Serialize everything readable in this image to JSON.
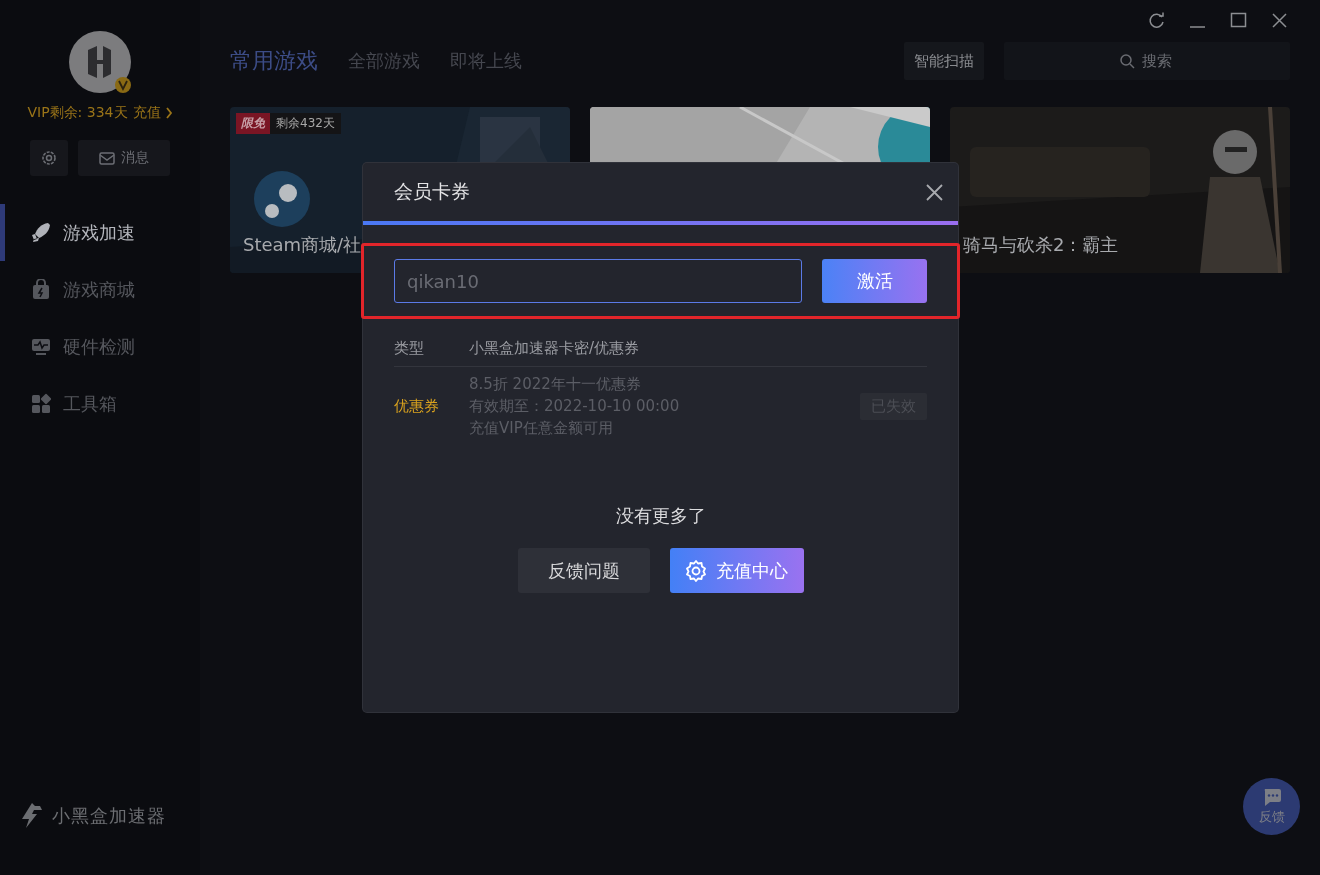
{
  "sidebar": {
    "vip_text": "VIP剩余: 334天",
    "recharge_link": "充值",
    "message_button": "消息",
    "nav": [
      {
        "label": "游戏加速",
        "selected": true
      },
      {
        "label": "游戏商城",
        "selected": false
      },
      {
        "label": "硬件检测",
        "selected": false
      },
      {
        "label": "工具箱",
        "selected": false
      }
    ],
    "brand": "小黑盒加速器"
  },
  "tabs": [
    {
      "label": "常用游戏",
      "selected": true
    },
    {
      "label": "全部游戏",
      "selected": false
    },
    {
      "label": "即将上线",
      "selected": false
    }
  ],
  "scan_button": "智能扫描",
  "search": {
    "placeholder": "搜索"
  },
  "games": [
    {
      "badge": "限免",
      "remaining": "剩余432天",
      "title": "Steam商城/社"
    },
    {
      "kind": "picture"
    },
    {
      "title": "骑马与砍杀2：霸主"
    }
  ],
  "modal": {
    "title": "会员卡券",
    "code": "qikan10",
    "activate_button": "激活",
    "columns": [
      "类型",
      "小黑盒加速器卡密/优惠券"
    ],
    "coupons": [
      {
        "type": "优惠券",
        "lines": [
          "8.5折 2022年十一优惠券",
          "有效期至：2022-10-10 00:00",
          "充值VIP任意金额可用"
        ],
        "status": "已失效",
        "expired": true
      }
    ],
    "end_text": "没有更多了",
    "buttons": [
      {
        "label": "反馈问题",
        "kind": "plain"
      },
      {
        "label": "充值中心",
        "kind": "primary"
      }
    ]
  },
  "feedback_fab": "反馈"
}
